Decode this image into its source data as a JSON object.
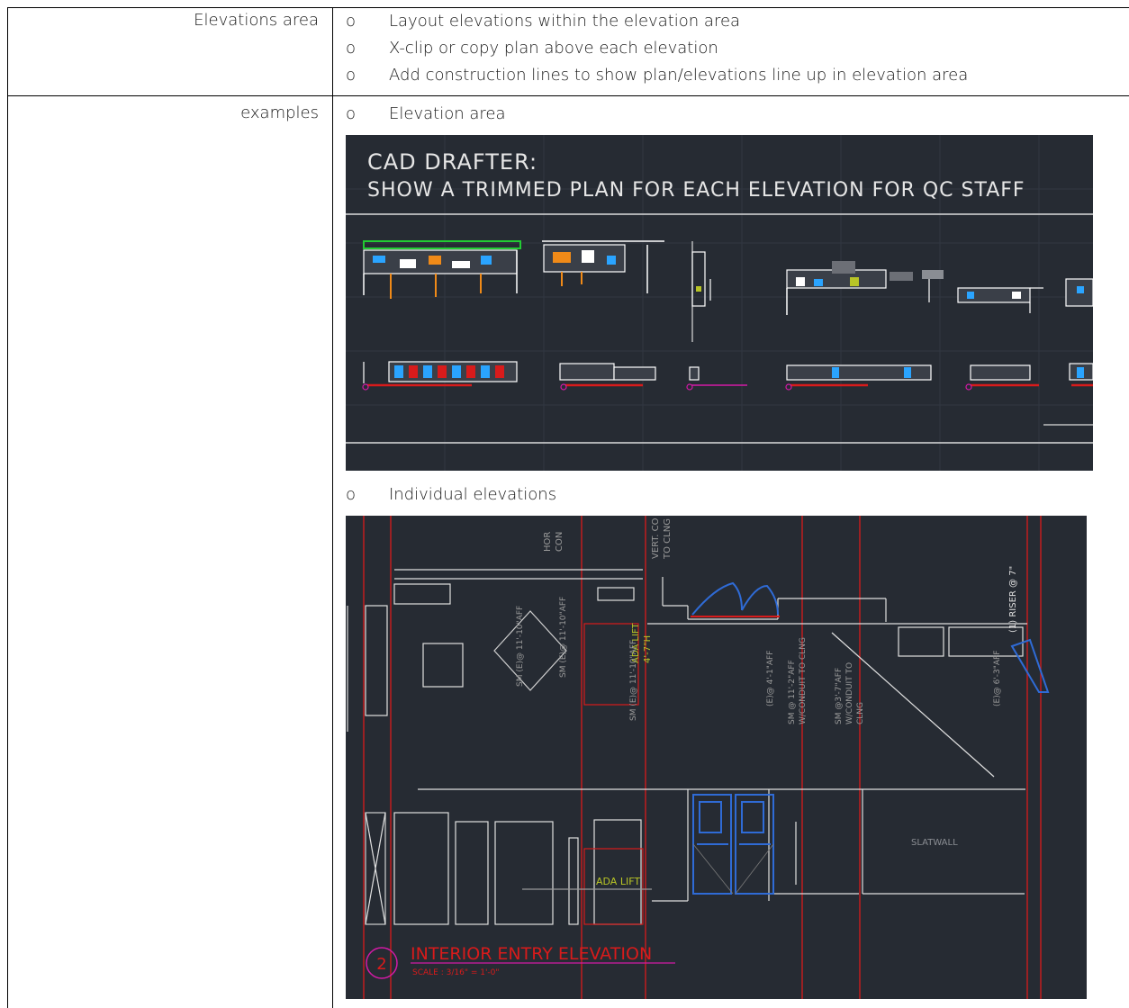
{
  "rows": [
    {
      "label": "Elevations area",
      "bullets": [
        "Layout elevations within the elevation area",
        "X-clip or copy plan above each elevation",
        "Add construction lines to show plan/elevations line up in elevation area"
      ]
    },
    {
      "label": "examples",
      "bullets": [
        "Elevation area",
        "Individual elevations"
      ]
    }
  ],
  "bullet_glyph": "o",
  "cad1": {
    "line1": "CAD DRAFTER:",
    "line2": "SHOW A TRIMMED PLAN FOR EACH ELEVATION FOR QC STAFF"
  },
  "cad2": {
    "title_num": "2",
    "title": "INTERIOR ENTRY ELEVATION",
    "scale": "SCALE : 3/16\" = 1'-0\"",
    "ann_ada_lift_top": "ADA LIFT",
    "ann_ada_lift_top_h": "4'-7\"H",
    "ann_ada_lift_bottom": "ADA LIFT",
    "ann_slatwall": "SLATWALL",
    "ann_riser": "(1) RISER @ 7\"",
    "ann_vert": "VERT. CO",
    "ann_vert2": "TO CLNG",
    "ann_hor": "HOR",
    "ann_hor2": "CON",
    "ann_sm1": "SM (E)@ 11'-10\"AFF",
    "ann_sm2": "SM (E)@ 11'-10\"AFF",
    "ann_sm3": "SM (E)@ 11'-10\"AFF",
    "ann_e4": "(E)@ 4'-1\"AFF",
    "ann_sm4": "SM @ 11'-2\"AFF",
    "ann_sm4b": "W/CONDUIT TO CLNG",
    "ann_sm5": "SM @3'-7\"AFF",
    "ann_sm5b": "W/CONDUIT TO",
    "ann_sm5c": "CLNG",
    "ann_e6": "(E)@ 6'-3\"AFF"
  },
  "colors": {
    "cad_bg": "#262b33",
    "red": "#d81b1b",
    "blue": "#2f6bd6",
    "magenta": "#d31aa6"
  }
}
